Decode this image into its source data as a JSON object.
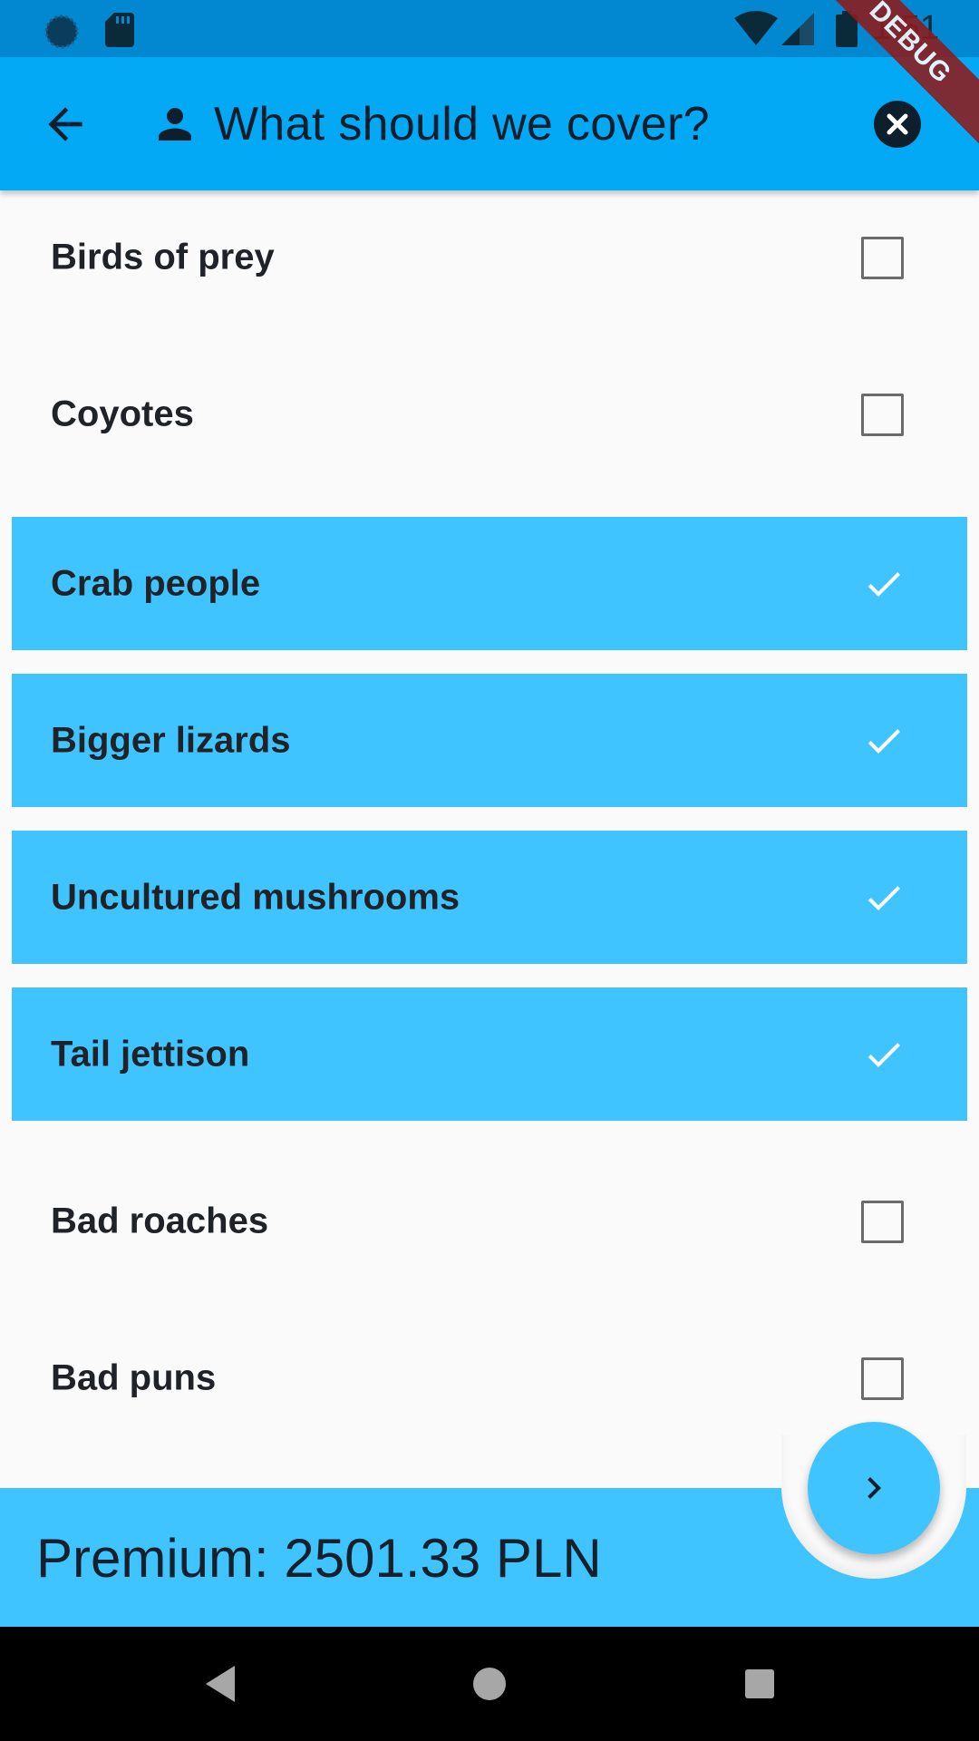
{
  "status_bar": {
    "time": "1:51",
    "icons": [
      "circle-notification-icon",
      "sd-card-icon",
      "wifi-icon",
      "cell-signal-icon",
      "battery-icon"
    ]
  },
  "app_bar": {
    "title": "What should we cover?",
    "leading_icon": "back-arrow-icon",
    "title_icon": "person-icon",
    "trailing_icon": "close-circle-icon",
    "background": "#03a9f4"
  },
  "debug_banner": {
    "label": "DEBUG"
  },
  "options": [
    {
      "label": "Birds of prey",
      "selected": false
    },
    {
      "label": "Coyotes",
      "selected": false
    },
    {
      "label": "Crab people",
      "selected": true
    },
    {
      "label": "Bigger lizards",
      "selected": true
    },
    {
      "label": "Uncultured mushrooms",
      "selected": true
    },
    {
      "label": "Tail jettison",
      "selected": true
    },
    {
      "label": "Bad roaches",
      "selected": false
    },
    {
      "label": "Bad puns",
      "selected": false
    }
  ],
  "colors": {
    "selected_row": "#40c4ff",
    "checkmark": "#ffffff",
    "unchecked_box": "#6b6b6b"
  },
  "bottom_bar": {
    "premium_text": "Premium: 2501.33 PLN",
    "background": "#40c4ff"
  },
  "fab": {
    "icon": "chevron-right-icon"
  },
  "nav_bar": {
    "buttons": [
      "back-triangle-icon",
      "home-circle-icon",
      "recents-square-icon"
    ]
  }
}
